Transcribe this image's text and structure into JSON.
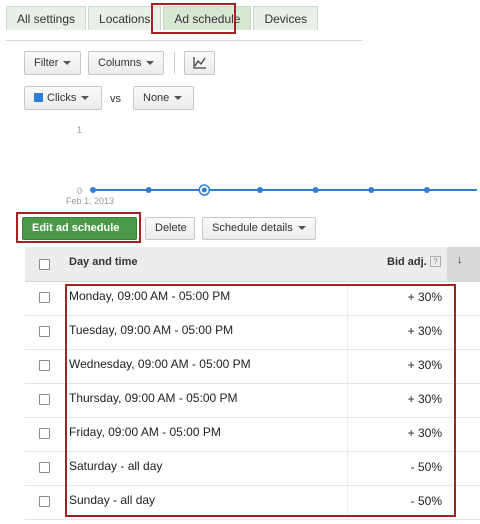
{
  "tabs": [
    {
      "label": "All settings",
      "selected": false
    },
    {
      "label": "Locations",
      "selected": false
    },
    {
      "label": "Ad schedule",
      "selected": true
    },
    {
      "label": "Devices",
      "selected": false
    }
  ],
  "toolbar": {
    "filter_label": "Filter",
    "columns_label": "Columns",
    "chart_icon": "line-chart-icon"
  },
  "metrics": {
    "primary_label": "Clicks",
    "primary_color": "#2f7fd6",
    "vs_label": "vs",
    "secondary_label": "None"
  },
  "chart_data": {
    "type": "line",
    "x_start_label": "Feb 1, 2013",
    "y_ticks": [
      "1",
      "0"
    ],
    "ylim": [
      0,
      1
    ],
    "series": [
      {
        "values": [
          0,
          0,
          0,
          0,
          0,
          0,
          0
        ],
        "color": "#2f7fd6",
        "selected_index": 2
      }
    ]
  },
  "actions": {
    "edit_label": "Edit ad schedule",
    "delete_label": "Delete",
    "details_label": "Schedule details"
  },
  "table": {
    "col_day": "Day and time",
    "col_bid": "Bid adj.",
    "help_glyph": "?",
    "sort_glyph": "↓",
    "rows": [
      {
        "day": "Monday, 09:00 AM - 05:00 PM",
        "bid": "+ 30%"
      },
      {
        "day": "Tuesday, 09:00 AM - 05:00 PM",
        "bid": "+ 30%"
      },
      {
        "day": "Wednesday, 09:00 AM - 05:00 PM",
        "bid": "+ 30%"
      },
      {
        "day": "Thursday, 09:00 AM - 05:00 PM",
        "bid": "+ 30%"
      },
      {
        "day": "Friday, 09:00 AM - 05:00 PM",
        "bid": "+ 30%"
      },
      {
        "day": "Saturday - all day",
        "bid": "- 50%"
      },
      {
        "day": "Sunday - all day",
        "bid": "- 50%"
      }
    ]
  },
  "highlight_color": "#a32222"
}
